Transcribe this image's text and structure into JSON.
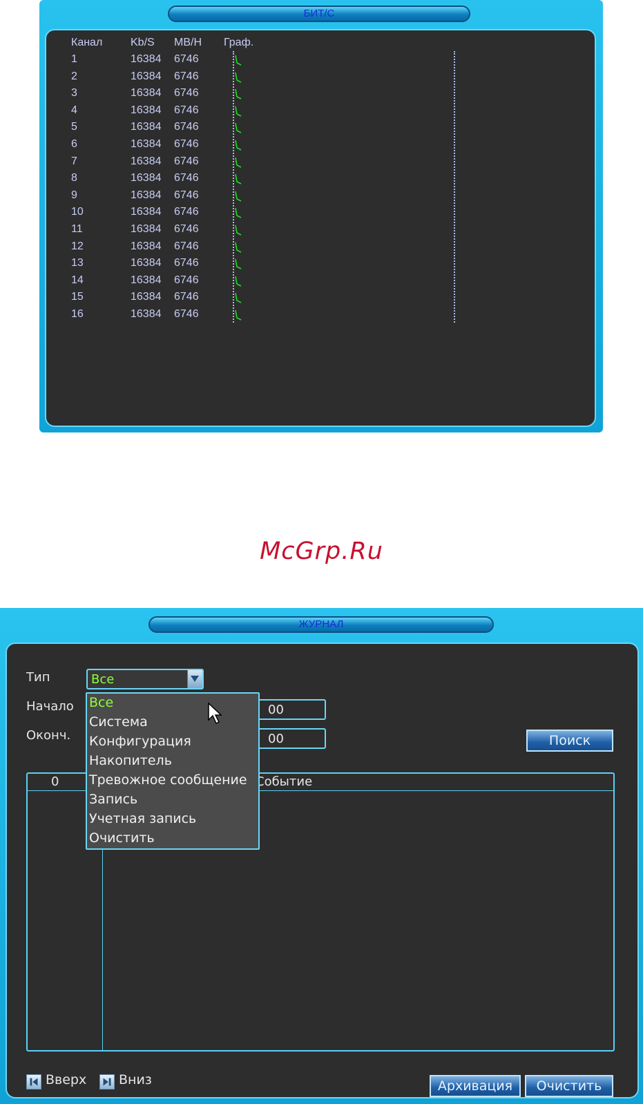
{
  "bitrate_panel": {
    "title": "БИТ/С",
    "headers": {
      "channel": "Канал",
      "kbs": "Kb/S",
      "mbh": "MB/H",
      "graph": "Граф."
    },
    "rows": [
      {
        "ch": "1",
        "kbs": "16384",
        "mbh": "6746"
      },
      {
        "ch": "2",
        "kbs": "16384",
        "mbh": "6746"
      },
      {
        "ch": "3",
        "kbs": "16384",
        "mbh": "6746"
      },
      {
        "ch": "4",
        "kbs": "16384",
        "mbh": "6746"
      },
      {
        "ch": "5",
        "kbs": "16384",
        "mbh": "6746"
      },
      {
        "ch": "6",
        "kbs": "16384",
        "mbh": "6746"
      },
      {
        "ch": "7",
        "kbs": "16384",
        "mbh": "6746"
      },
      {
        "ch": "8",
        "kbs": "16384",
        "mbh": "6746"
      },
      {
        "ch": "9",
        "kbs": "16384",
        "mbh": "6746"
      },
      {
        "ch": "10",
        "kbs": "16384",
        "mbh": "6746"
      },
      {
        "ch": "11",
        "kbs": "16384",
        "mbh": "6746"
      },
      {
        "ch": "12",
        "kbs": "16384",
        "mbh": "6746"
      },
      {
        "ch": "13",
        "kbs": "16384",
        "mbh": "6746"
      },
      {
        "ch": "14",
        "kbs": "16384",
        "mbh": "6746"
      },
      {
        "ch": "15",
        "kbs": "16384",
        "mbh": "6746"
      },
      {
        "ch": "16",
        "kbs": "16384",
        "mbh": "6746"
      }
    ]
  },
  "watermark": "McGrp.Ru",
  "journal_panel": {
    "title": "ЖУРНАЛ",
    "type_label": "Тип",
    "type_value": "Все",
    "start_label": "Начало",
    "start_time_value": "00",
    "end_label": "Оконч.",
    "end_time_value": "00",
    "search_button": "Поиск",
    "table_headers": {
      "index": "0",
      "event": "Событие"
    },
    "dropdown_options": [
      "Все",
      "Система",
      "Конфигурация",
      "Накопитель",
      "Тревожное сообщение",
      "Запись",
      "Учетная запись",
      "Очистить"
    ],
    "nav_up": "Вверх",
    "nav_down": "Вниз",
    "archive_button": "Архивация",
    "clear_button": "Очистить"
  },
  "colors": {
    "frame_blue": "#1fb4e6",
    "panel_bg": "#2d2d2d",
    "graph_green": "#22dd22",
    "selected_green": "#8cff3a",
    "watermark_red": "#c8102e"
  }
}
